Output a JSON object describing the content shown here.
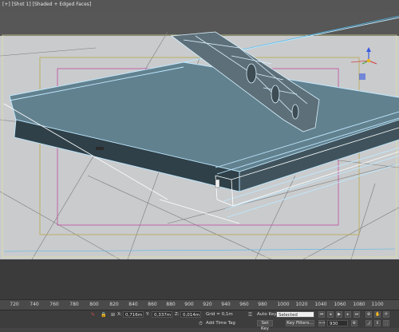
{
  "viewport": {
    "label_parts": [
      "[+]",
      "[Shot 1]",
      "[Shaded + Edged Faces]"
    ]
  },
  "timeline": {
    "ticks": [
      "720",
      "740",
      "760",
      "780",
      "800",
      "820",
      "840",
      "860",
      "880",
      "900",
      "920",
      "940",
      "960",
      "980",
      "1000",
      "1020",
      "1040",
      "1060",
      "1080",
      "1100"
    ]
  },
  "status": {
    "x_label": "X:",
    "x_value": "0,716m",
    "y_label": "Y:",
    "y_value": "0,337m",
    "z_label": "Z:",
    "z_value": "0,014m",
    "grid": "Grid = 0,1m",
    "add_time_tag": "Add Time Tag",
    "auto_key": "Auto Key",
    "selected": "Selected",
    "set_key": "Set Key",
    "key_filters": "Key Filters...",
    "frame": "930"
  },
  "colors": {
    "viewport_bg": "#565656",
    "floor": "#c9cbcd",
    "wire": "#bfe9ff",
    "panel_fill": "#5f7f8e",
    "edge_dark": "#2f3f47",
    "safe_frame_yellow": "#b8a84a",
    "safe_frame_magenta": "#c24aa0"
  },
  "icons": {
    "viewcube": "viewcube-gizmo-icon",
    "lock": "lock-icon",
    "key": "key-icon"
  }
}
